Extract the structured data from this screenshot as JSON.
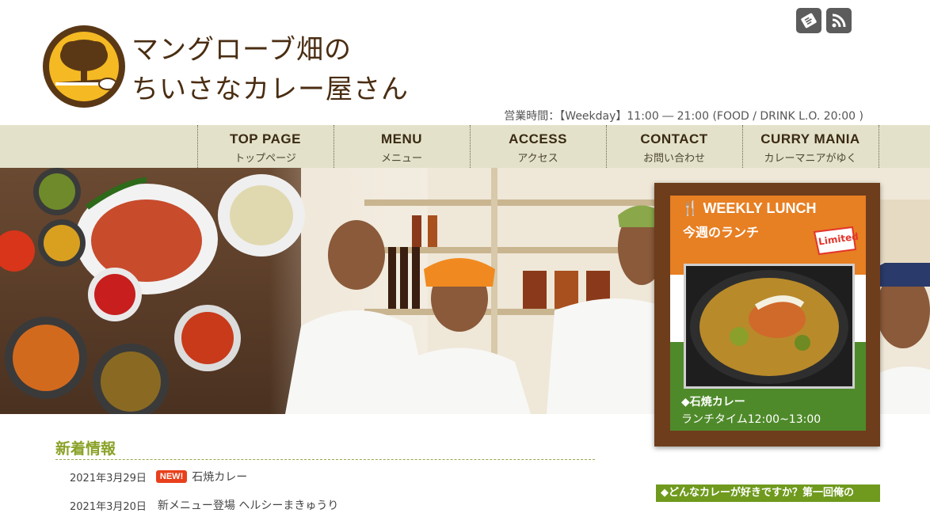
{
  "header": {
    "title_line1": "マングローブ畑の",
    "title_line2": "ちいさなカレー屋さん",
    "hours": "営業時間：【Weekday】11:00 ― 21:00 (FOOD / DRINK L.O. 20:00 )",
    "social": [
      "hatena-icon",
      "rss-icon"
    ]
  },
  "nav": [
    {
      "en": "TOP PAGE",
      "ja": "トップページ"
    },
    {
      "en": "MENU",
      "ja": "メニュー"
    },
    {
      "en": "ACCESS",
      "ja": "アクセス"
    },
    {
      "en": "CONTACT",
      "ja": "お問い合わせ"
    },
    {
      "en": "CURRY MANIA",
      "ja": "カレーマニアがゆく"
    }
  ],
  "lunch": {
    "title_en": "WEEKLY LUNCH",
    "title_ja": "今週のランチ",
    "limited": "Limited",
    "dish": "石焼カレー",
    "time": "ランチタイム12:00~13:00"
  },
  "news": {
    "heading": "新着情報",
    "items": [
      {
        "date": "2021年3月29日",
        "badge": "NEW!",
        "text": "石焼カレー"
      },
      {
        "date": "2021年3月20日",
        "badge": "",
        "text": "新メニュー登場 ヘルシーまきゅうり"
      }
    ]
  },
  "side_banner": "どんなカレーが好きですか？第一回俺の",
  "colors": {
    "accent": "#8aa228",
    "nav_bg": "#e3e1c9",
    "brand_brown": "#4a2d12",
    "logo_yellow": "#f5b923"
  }
}
